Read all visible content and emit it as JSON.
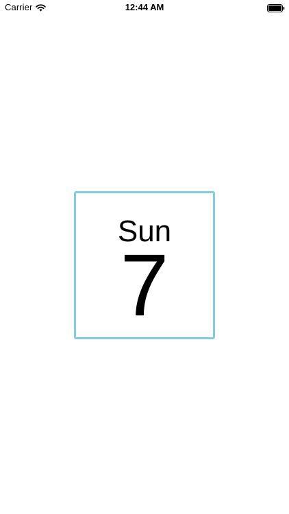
{
  "status_bar": {
    "carrier": "Carrier",
    "time": "12:44 AM",
    "icons": [
      "wifi-icon",
      "battery-icon"
    ]
  },
  "date_tile": {
    "day_name": "Sun",
    "day_number": "7",
    "border_color": "#7ecce6"
  }
}
